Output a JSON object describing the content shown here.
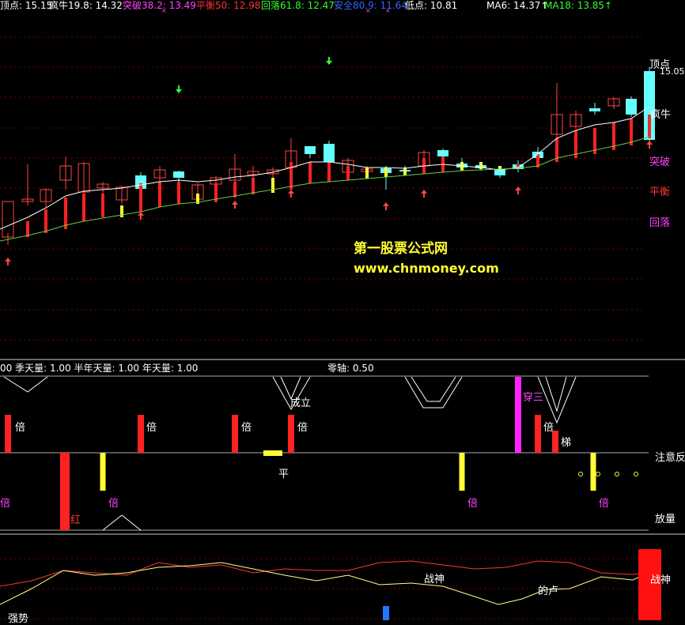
{
  "header": {
    "items": [
      {
        "text": "顶点: 15.15",
        "color": "#ffffff"
      },
      {
        "text": "疯牛19.8: 14.32",
        "color": "#ffffff"
      },
      {
        "text": "突破38.2: 13.49",
        "color": "#ff44ff"
      },
      {
        "text": "平衡50: 12.98",
        "color": "#ff3333"
      },
      {
        "text": "回落61.8: 12.47",
        "color": "#33ff33"
      },
      {
        "text": "安全80.9: 11.64",
        "color": "#3366ff"
      },
      {
        "text": "低点: 10.81",
        "color": "#ffffff"
      },
      {
        "text": "MA6: 14.37↑",
        "color": "#ffffff"
      },
      {
        "text": "MA18: 13.85↑",
        "color": "#33ff33"
      }
    ]
  },
  "right_labels": {
    "top": "顶点",
    "price": "15.05",
    "mad": "疯牛",
    "breakout": "突破",
    "balance": "平衡",
    "fallback": "回落"
  },
  "watermark": {
    "line1": "第一股票公式网",
    "line2": "www.chnmoney.com"
  },
  "sub_header": {
    "left": "00 季天量: 1.00 半年天量: 1.00 年天量: 1.00",
    "zero_axis": "零轴: 0.50"
  },
  "panel2_labels": {
    "established": "成立",
    "pierce_three": "穿三",
    "ladder": "梯",
    "flat": "平",
    "red": "红",
    "attention": "注意反",
    "volume_up": "放量",
    "bei": "倍"
  },
  "panel3_labels": {
    "war_god_1": "战神",
    "war_god_2": "战神",
    "war_god_bar": "战神",
    "gourd": "的卢",
    "bottom_left": "强势"
  },
  "colors": {
    "grid": "#7a0000",
    "up": "#ff4444",
    "down": "#66ffff",
    "ma_white": "#ffffff",
    "ma_green": "#66cc44"
  }
}
